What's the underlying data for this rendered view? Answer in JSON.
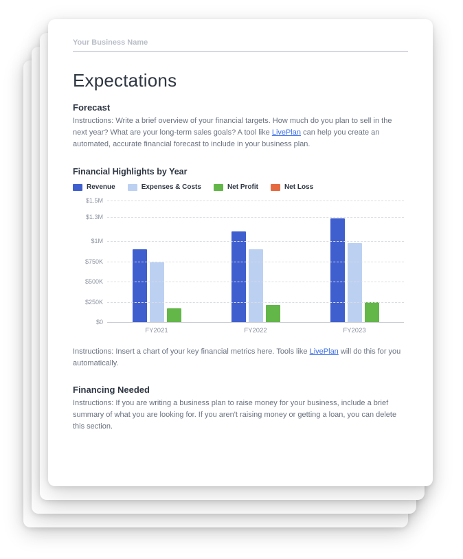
{
  "header": {
    "business_name": "Your Business Name"
  },
  "title": "Expectations",
  "forecast": {
    "heading": "Forecast",
    "text_pre": "Instructions: Write a brief overview of your financial targets. How much do you plan to sell in the next year? What are your long-term sales goals? A tool like ",
    "link": "LivePlan",
    "text_post": " can help you create an automated, accurate financial forecast to include in your business plan."
  },
  "chart_caption": {
    "text_pre": "Instructions: Insert a chart of your key financial metrics here. Tools like ",
    "link": "LivePlan",
    "text_post": " will do this for you automatically."
  },
  "financing": {
    "heading": "Financing Needed",
    "text": "Instructions: If you are writing a business plan to raise money for your business, include a brief summary of what you are looking for. If you aren't raising money or getting a loan, you can delete this section."
  },
  "colors": {
    "revenue": "#3f5fcf",
    "expenses": "#bcd0f2",
    "netprofit": "#63b648",
    "netloss": "#e66a3f"
  },
  "chart_data": {
    "type": "bar",
    "title": "Financial Highlights by Year",
    "xlabel": "",
    "ylabel": "",
    "ylim": [
      0,
      1500000
    ],
    "y_ticks": [
      "$0",
      "$250K",
      "$500K",
      "$750K",
      "$1M",
      "$1.3M",
      "$1.5M"
    ],
    "categories": [
      "FY2021",
      "FY2022",
      "FY2023"
    ],
    "series": [
      {
        "name": "Revenue",
        "color_key": "revenue",
        "values": [
          900000,
          1120000,
          1280000
        ]
      },
      {
        "name": "Expenses & Costs",
        "color_key": "expenses",
        "values": [
          740000,
          900000,
          980000
        ]
      },
      {
        "name": "Net Profit",
        "color_key": "netprofit",
        "values": [
          170000,
          210000,
          250000
        ]
      },
      {
        "name": "Net Loss",
        "color_key": "netloss",
        "values": [
          0,
          0,
          0
        ]
      }
    ]
  }
}
